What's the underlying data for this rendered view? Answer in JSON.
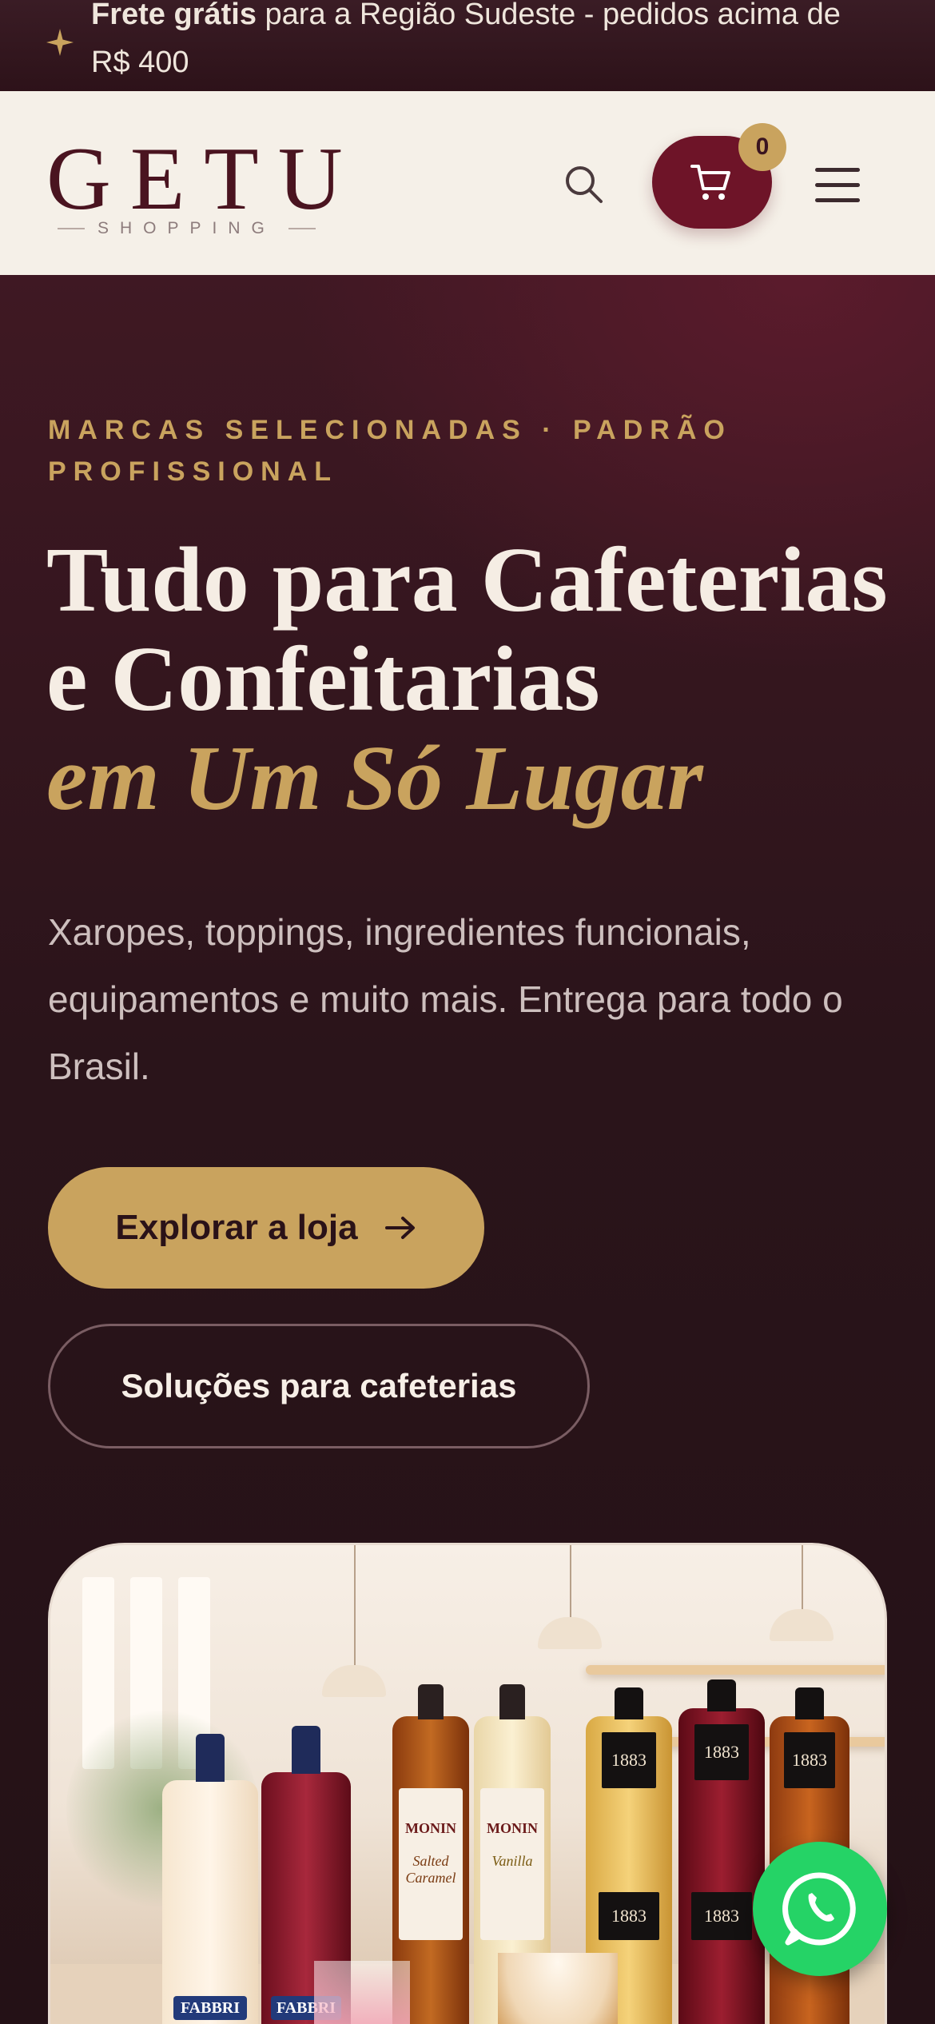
{
  "announcement": {
    "bold": "Frete grátis",
    "text": " para a Região Sudeste - pedidos acima de R$ 400"
  },
  "header": {
    "logo_word": "GETU",
    "logo_sub": "SHOPPING",
    "cart_count": "0",
    "icons": [
      "search-icon",
      "cart-icon",
      "menu-icon"
    ]
  },
  "hero": {
    "eyebrow": "MARCAS SELECIONADAS · PADRÃO PROFISSIONAL",
    "title_line1": "Tudo para Cafeterias",
    "title_line2": "e Confeitarias",
    "title_em": "em Um Só Lugar",
    "lead": "Xaropes, toppings, ingredientes funcionais, equipamentos e muito mais. Entrega para todo o Brasil.",
    "primary_cta": "Explorar a loja",
    "secondary_cta": "Soluções para cafeterias"
  },
  "product_image": {
    "labels": {
      "fabbri": "FABBRI",
      "monin": "MONIN",
      "monin_flavor1": "Salted Caramel",
      "monin_flavor2": "Vanilla",
      "brand_1883": "1883"
    }
  },
  "colors": {
    "accent_gold": "#c9a35e",
    "brand_wine": "#6e1428",
    "whatsapp_green": "#25d366",
    "header_bg": "#f5f0e8"
  }
}
